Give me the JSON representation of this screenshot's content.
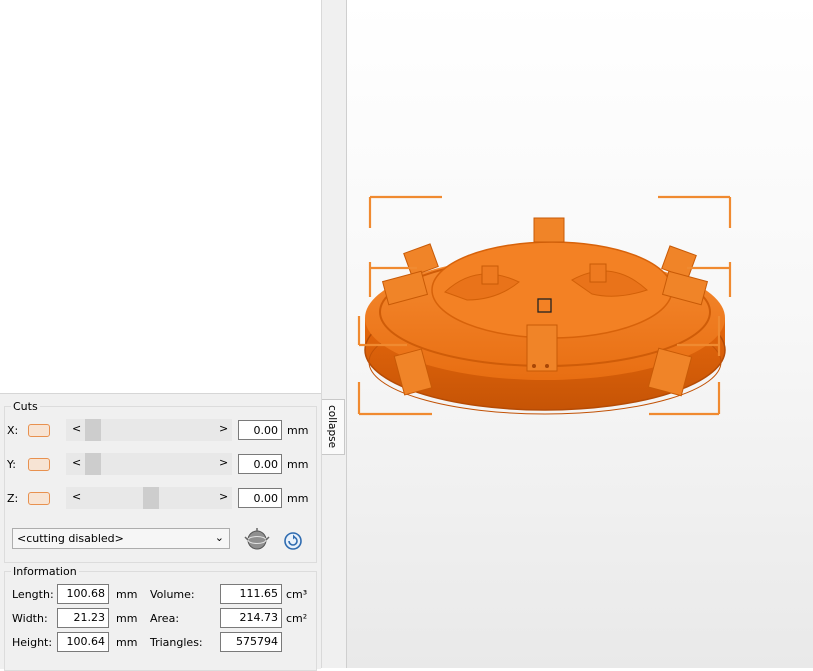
{
  "cuts": {
    "title": "Cuts",
    "axes": [
      {
        "label": "X:",
        "value": "0.00",
        "unit": "mm",
        "slider_position": 0.0
      },
      {
        "label": "Y:",
        "value": "0.00",
        "unit": "mm",
        "slider_position": 0.0
      },
      {
        "label": "Z:",
        "value": "0.00",
        "unit": "mm",
        "slider_position": 0.5
      }
    ],
    "mode_select": "<cutting disabled>",
    "arrow_left": "<",
    "arrow_right": ">"
  },
  "collapse_label": "collapse",
  "information": {
    "title": "Information",
    "length": {
      "label": "Length:",
      "value": "100.68",
      "unit": "mm"
    },
    "width": {
      "label": "Width:",
      "value": "21.23",
      "unit": "mm"
    },
    "height": {
      "label": "Height:",
      "value": "100.64",
      "unit": "mm"
    },
    "volume": {
      "label": "Volume:",
      "value": "111.65",
      "unit": "cm³"
    },
    "area": {
      "label": "Area:",
      "value": "214.73",
      "unit": "cm²"
    },
    "triangles": {
      "label": "Triangles:",
      "value": "575794"
    }
  },
  "colors": {
    "model": "#f07a1e",
    "selection": "#f08a30",
    "accent": "#e8914f"
  },
  "icons": {
    "cut-tool": "sphere-cut-icon",
    "reset": "reset-rotation-icon"
  }
}
